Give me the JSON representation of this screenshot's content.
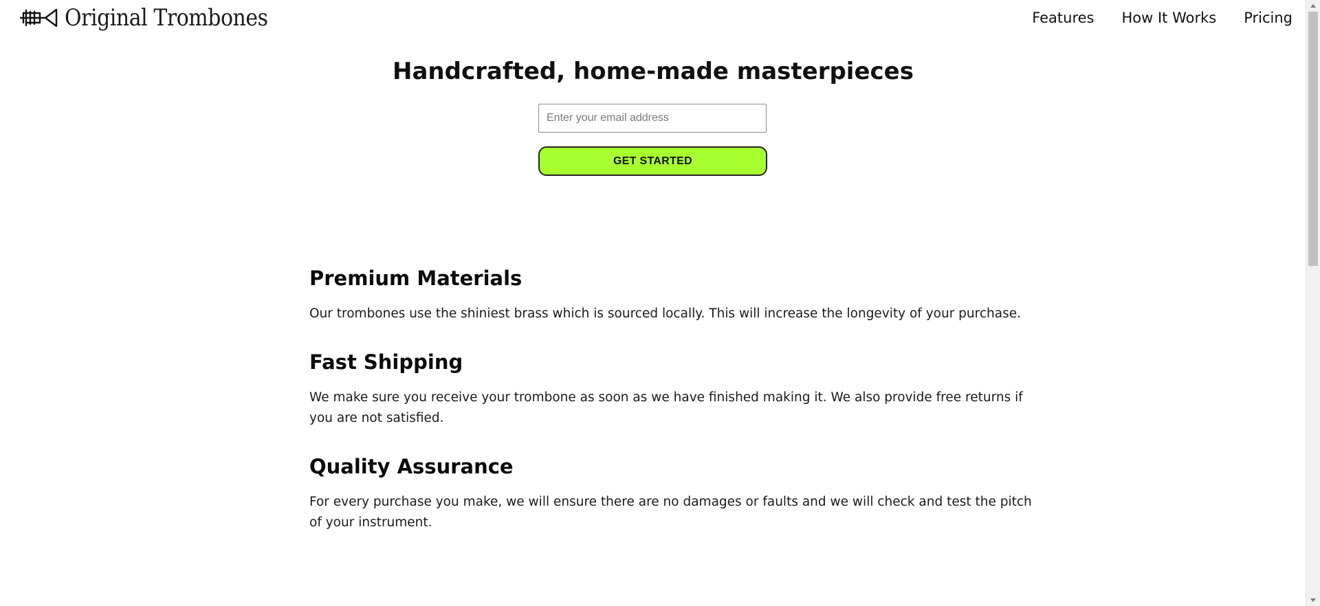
{
  "brand": {
    "name": "Original Trombones",
    "logo_icon": "trombone-icon"
  },
  "nav": {
    "items": [
      "Features",
      "How It Works",
      "Pricing"
    ]
  },
  "hero": {
    "title": "Handcrafted, home-made masterpieces",
    "email_placeholder": "Enter your email address",
    "cta_label": "GET STARTED"
  },
  "features": [
    {
      "title": "Premium Materials",
      "text": "Our trombones use the shiniest brass which is sourced locally. This will increase the longevity of your purchase."
    },
    {
      "title": "Fast Shipping",
      "text": "We make sure you receive your trombone as soon as we have finished making it. We also provide free returns if you are not satisfied."
    },
    {
      "title": "Quality Assurance",
      "text": "For every purchase you make, we will ensure there are no damages or faults and we will check and test the pitch of your instrument."
    }
  ],
  "colors": {
    "cta_background": "#a8ff2f",
    "text": "#111111",
    "background": "#ffffff"
  }
}
